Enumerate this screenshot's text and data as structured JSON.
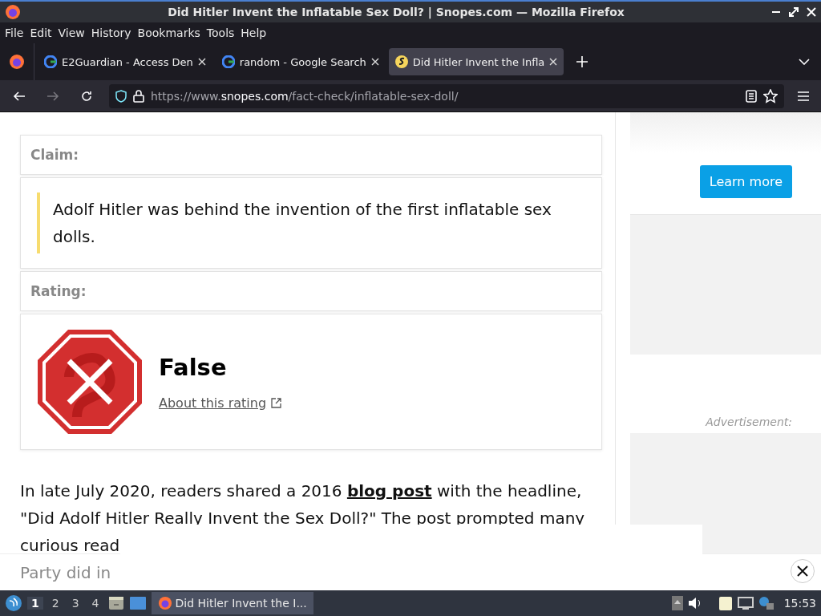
{
  "window": {
    "title": "Did Hitler Invent the Inflatable Sex Doll? | Snopes.com — Mozilla Firefox"
  },
  "menu": [
    "File",
    "Edit",
    "View",
    "History",
    "Bookmarks",
    "Tools",
    "Help"
  ],
  "tabs": [
    {
      "title": "E2Guardian - Access Den",
      "kind": "google",
      "selected": false
    },
    {
      "title": "random - Google Search",
      "kind": "google",
      "selected": false
    },
    {
      "title": "Did Hitler Invent the Infla",
      "kind": "snopes",
      "selected": true
    }
  ],
  "address": {
    "prefix": "https://www.",
    "domain": "snopes.com",
    "path": "/fact-check/inflatable-sex-doll/"
  },
  "article": {
    "claim_label": "Claim:",
    "claim": "Adolf Hitler was behind the invention of the first inflatable sex dolls.",
    "rating_label": "Rating:",
    "rating": "False",
    "rating_link": "About this rating",
    "lines": [
      {
        "before": "In late July 2020, readers shared a 2016 ",
        "link": "blog post",
        "after": " with the headline,"
      },
      {
        "before": "\"Did Adolf Hitler Really Invent the Sex Doll?\" The post prompted many"
      },
      {
        "before": "curious read"
      },
      {
        "before": "Party did in",
        "faded": true
      }
    ]
  },
  "sidebar": {
    "button": "Learn more",
    "ad_label": "Advertisement:"
  },
  "taskbar": {
    "workspaces": [
      {
        "label": "1",
        "selected": true
      },
      {
        "label": "2",
        "selected": false
      },
      {
        "label": "3",
        "selected": false
      },
      {
        "label": "4",
        "selected": false
      }
    ],
    "window_button": "Did Hitler Invent the I...",
    "clock": "15:53"
  }
}
